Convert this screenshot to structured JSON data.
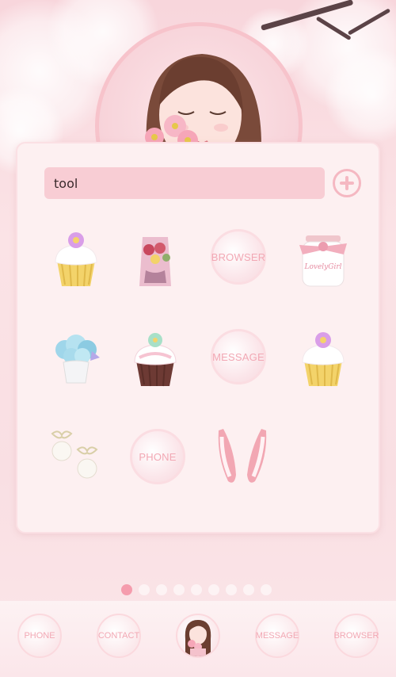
{
  "folder": {
    "name_value": "tool",
    "add_icon": "plus-circle-icon"
  },
  "apps": [
    {
      "icon": "cupcake-purple-icon"
    },
    {
      "icon": "rose-sachet-icon"
    },
    {
      "label": "BROWSER"
    },
    {
      "icon": "lovely-girl-jar-icon",
      "jar_text": "LovelyGirl"
    },
    {
      "icon": "blue-flower-pot-icon"
    },
    {
      "icon": "cupcake-green-icon"
    },
    {
      "label": "MESSAGE"
    },
    {
      "icon": "cupcake-purple-icon"
    },
    {
      "icon": "pearl-earrings-icon"
    },
    {
      "label": "PHONE"
    },
    {
      "icon": "pink-heels-icon"
    }
  ],
  "pager": {
    "count": 9,
    "active_index": 0
  },
  "dock": {
    "phone": "PHONE",
    "contact": "CONTACT",
    "avatar_icon": "girl-avatar-icon",
    "message": "MESSAGE",
    "browser": "BROWSER"
  },
  "colors": {
    "accent": "#f59cad",
    "label": "#f2a8b4",
    "panel": "#fdf0f1"
  }
}
